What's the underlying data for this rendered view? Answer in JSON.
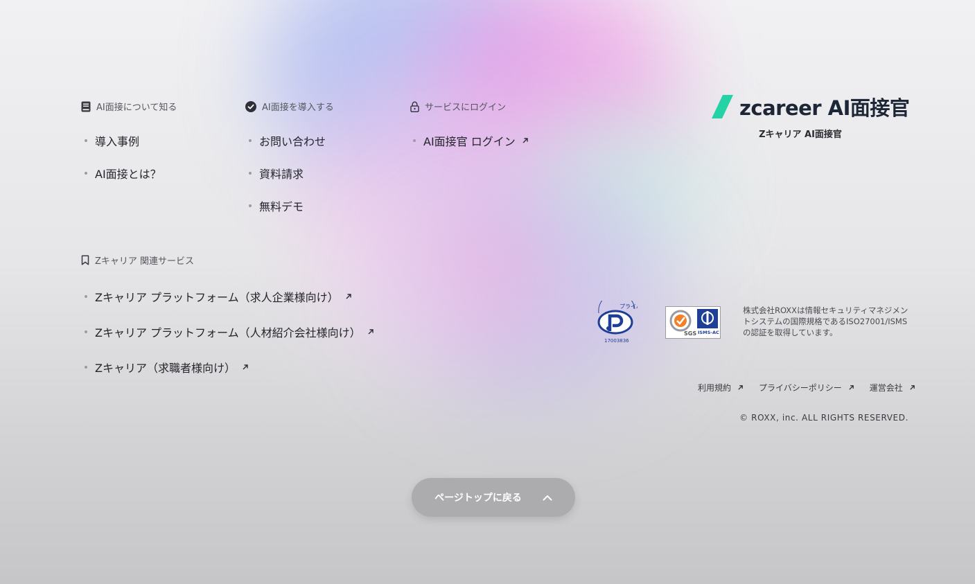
{
  "colors": {
    "brand_green": "#23d3a6",
    "brand_navy": "#1d2636",
    "button_bg": "#acacaf"
  },
  "about": {
    "heading": "AI面接について知る",
    "heading_icon": "book-icon",
    "items": [
      {
        "label": "導入事例"
      },
      {
        "label": "AI面接とは？"
      }
    ]
  },
  "introduce": {
    "heading": "AI面接を導入する",
    "heading_icon": "check-circle-icon",
    "items": [
      {
        "label": "お問い合わせ"
      },
      {
        "label": "資料請求"
      },
      {
        "label": "無料デモ"
      }
    ]
  },
  "login": {
    "heading": "サービスにログイン",
    "heading_icon": "lock-icon",
    "items": [
      {
        "label": "AI面接官 ログイン"
      }
    ]
  },
  "related": {
    "heading": "Zキャリア 関連サービス",
    "heading_icon": "bookmark-icon",
    "items": [
      {
        "label": "Zキャリア プラットフォーム（求人企業様向け）"
      },
      {
        "label": "Zキャリア プラットフォーム（人材紹介会社様向け）"
      },
      {
        "label": "Zキャリア（求職者様向け）"
      }
    ]
  },
  "brand": {
    "logo_text": "zcareer AI面接官",
    "subtitle": "Zキャリア AI面接官"
  },
  "certification": {
    "privacy_mark_number": "17003836",
    "privacy_mark_text": "プライバシー",
    "isms_logo_text": "ISMS-AC",
    "sgs_logo_text": "SGS",
    "text": "株式会社ROXXは情報セキュリティマネジメントシステムの国際規格であるISO27001/ISMSの認証を取得しています。"
  },
  "footer_links": [
    {
      "label": "利用規約"
    },
    {
      "label": "プライバシーポリシー"
    },
    {
      "label": "運営会社"
    }
  ],
  "copyright": "© ROXX, inc. ALL RIGHTS RESERVED.",
  "back_to_top": {
    "label": "ページトップに戻る",
    "icon": "chevron-up-icon"
  }
}
